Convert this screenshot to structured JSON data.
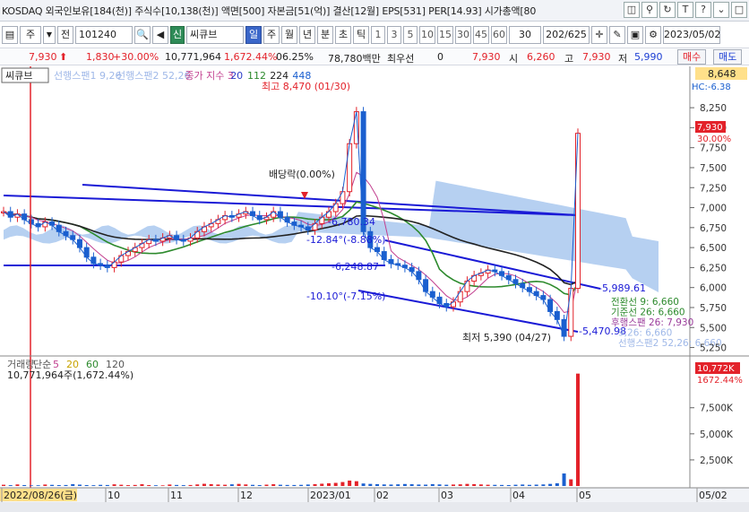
{
  "topbar": {
    "info": "KOSDAQ 외국인보유[184(천)] 주식수[10,138(천)] 액면[500] 자본금[51(억)] 결산[12월] EPS[531] PER[14.93] 시가총액[80",
    "icons": [
      "◫",
      "⚲",
      "↻",
      "T",
      "?",
      "⌄",
      "□"
    ]
  },
  "toolbar": {
    "box1": "▤",
    "period_type": "주",
    "period_arrow": "▼",
    "jeon": "전",
    "code": "101240",
    "search": "🔍",
    "sound": "◀",
    "sin": "신",
    "name": "씨큐브",
    "periods": [
      "일",
      "주",
      "월",
      "년",
      "분",
      "초",
      "틱"
    ],
    "numbers": [
      "1",
      "3",
      "5",
      "10",
      "15",
      "30",
      "45",
      "60"
    ],
    "count": "30",
    "page": "202/625",
    "date": "2023/05/02"
  },
  "quote": {
    "price": "7,930",
    "change": "1,830",
    "rate": "+30.00%",
    "volume": "10,771,964",
    "vol_rate": "1,672.44%",
    "ratio": "06.25%",
    "amount": "78,780백만",
    "pref_label": "최우선",
    "pref_value": "0",
    "ask": "7,930",
    "open_label": "시",
    "open": "6,260",
    "high_label": "고",
    "high": "7,930",
    "low_label": "저",
    "low": "5,990",
    "buy": "매수",
    "sell": "매도"
  },
  "chart_data": {
    "type": "line",
    "title": "씨큐브",
    "legend": [
      {
        "text": "선행스팬1 9,26",
        "color": "#9fb8e8"
      },
      {
        "text": "선행스팬2 52,26",
        "color": "#9fb8e8"
      },
      {
        "text": "종가 지수 3",
        "color": "#c23f8f"
      },
      {
        "text": "20",
        "color": "#2c3ec8"
      },
      {
        "text": "112",
        "color": "#2d8a2d"
      },
      {
        "text": "224",
        "color": "#222222"
      },
      {
        "text": "448",
        "color": "#1a5fcf"
      }
    ],
    "ylim": [
      5200,
      8700
    ],
    "y_ticks": [
      5250,
      5500,
      5750,
      6000,
      6250,
      6500,
      6750,
      7000,
      7250,
      7500,
      7750,
      8000,
      8250
    ],
    "y_tick_labels": [
      "5,250",
      "5,500",
      "5,750",
      "6,000",
      "6,250",
      "6,500",
      "6,750",
      "7,000",
      "7,250",
      "7,500",
      "7,750",
      "8,000",
      "8,250"
    ],
    "x_labels": [
      "2022/08/26(금)",
      "10",
      "11",
      "12",
      "2023/01",
      "02",
      "03",
      "04",
      "05",
      "05/02"
    ],
    "annotations": {
      "high": "최고 8,470 (01/30)",
      "low": "최저 5,390 (04/27)",
      "dividend": "배당락(0.00%)",
      "trend1": "-6,780.34",
      "trend2": "-6,248.87",
      "trend3": "-5,989.61",
      "trend4": "-5,470.98",
      "angle1": "-12.84°(-8.88%)",
      "angle2": "-10.10°(-7.15%)"
    },
    "right_labels": {
      "top_price": "8,648",
      "hc": "HC:-6.38",
      "current": "7,930",
      "current_pct": "30.00%"
    },
    "indicator_labels": [
      {
        "text": "전환선 9: 6,660",
        "color": "#2d8a2d"
      },
      {
        "text": "기준선 26: 6,660",
        "color": "#2d8a2d"
      },
      {
        "text": "후행스팬 26: 7,930",
        "color": "#9b3c9b"
      },
      {
        "text": "9,26: 6,660",
        "color": "#9fb8e8"
      },
      {
        "text": "선행스팬2 52,26: 6,660",
        "color": "#9fb8e8"
      }
    ],
    "closes": [
      6950,
      6880,
      6920,
      6850,
      6800,
      6760,
      6820,
      6780,
      6700,
      6650,
      6600,
      6500,
      6380,
      6300,
      6280,
      6250,
      6320,
      6400,
      6450,
      6500,
      6550,
      6600,
      6580,
      6620,
      6650,
      6600,
      6580,
      6620,
      6700,
      6760,
      6800,
      6850,
      6900,
      6880,
      6920,
      6950,
      6900,
      6850,
      6880,
      6950,
      6880,
      6820,
      6780,
      6760,
      6720,
      6800,
      6880,
      6950,
      7050,
      7200,
      7800,
      8200,
      6700,
      6500,
      6450,
      6350,
      6300,
      6280,
      6250,
      6200,
      6100,
      5950,
      5880,
      5800,
      5760,
      5820,
      5950,
      6080,
      6150,
      6180,
      6220,
      6200,
      6150,
      6100,
      6050,
      6000,
      5950,
      5900,
      5850,
      5700,
      5600,
      5390,
      5990,
      7930
    ]
  },
  "volume_chart": {
    "title": "거래량 단순 5 20 60 120",
    "title_parts": [
      {
        "text": "거래량",
        "color": "#555555"
      },
      {
        "text": "단순",
        "color": "#555555"
      },
      {
        "text": "5",
        "color": "#c23f8f"
      },
      {
        "text": "20",
        "color": "#c8a300"
      },
      {
        "text": "60",
        "color": "#2d8a2d"
      },
      {
        "text": "120",
        "color": "#555555"
      }
    ],
    "subtitle": "10,771,964주(1,672.44%)",
    "y_labels": [
      "2,500K",
      "5,000K",
      "7,500K"
    ],
    "current_label": "10,772K",
    "current_pct": "1672.44%",
    "values_k": [
      120,
      80,
      150,
      90,
      60,
      70,
      140,
      110,
      85,
      95,
      180,
      130,
      90,
      75,
      110,
      95,
      160,
      120,
      80,
      100,
      170,
      90,
      70,
      60,
      140,
      100,
      80,
      95,
      150,
      210,
      180,
      140,
      120,
      160,
      200,
      150,
      110,
      90,
      130,
      170,
      120,
      100,
      95,
      110,
      140,
      180,
      220,
      260,
      300,
      380,
      520,
      460,
      240,
      200,
      180,
      150,
      140,
      160,
      190,
      170,
      140,
      130,
      180,
      150,
      120,
      140,
      160,
      200,
      180,
      150,
      120,
      110,
      100,
      90,
      120,
      140,
      110,
      130,
      150,
      200,
      260,
      1200,
      640,
      10772
    ]
  }
}
